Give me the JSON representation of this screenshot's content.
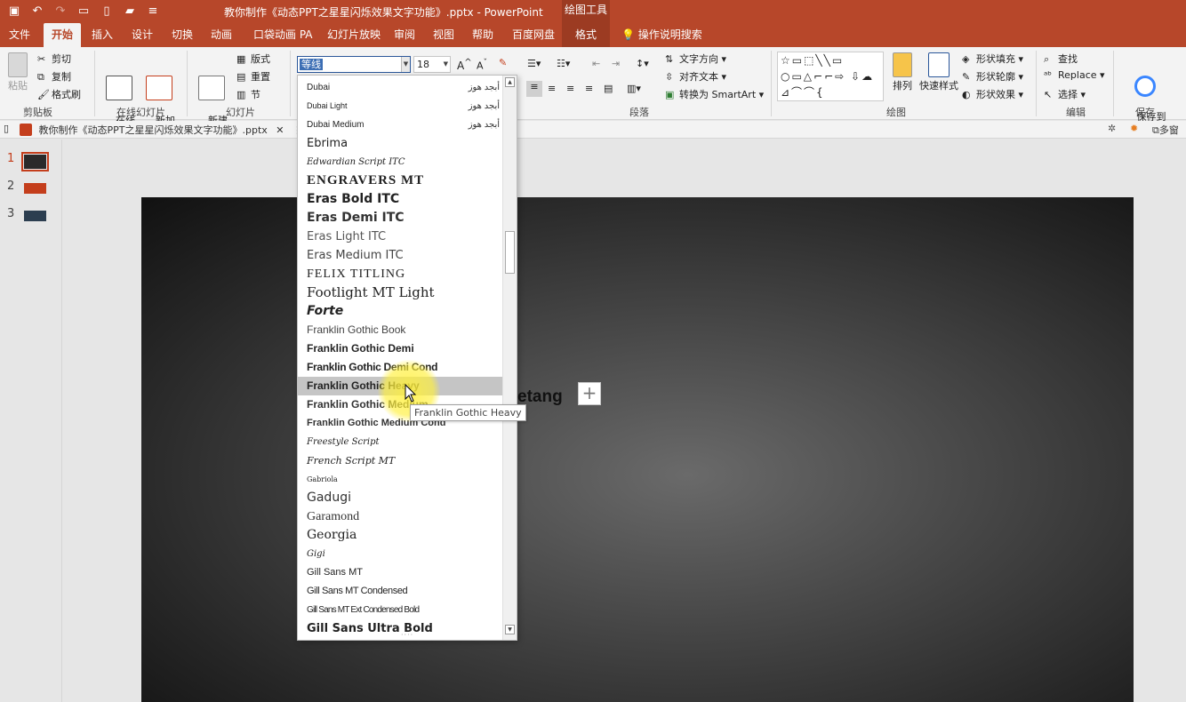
{
  "window": {
    "title": "教你制作《动态PPT之星星闪烁效果文字功能》.pptx - PowerPoint",
    "context_label": "绘图工具"
  },
  "qat": {
    "icons": [
      "save-icon",
      "undo-icon",
      "redo-icon",
      "presentation-start-icon",
      "new-file-icon",
      "open-folder-icon",
      "customize-icon"
    ]
  },
  "tabs": [
    {
      "label": "文件"
    },
    {
      "label": "开始"
    },
    {
      "label": "插入"
    },
    {
      "label": "设计"
    },
    {
      "label": "切换"
    },
    {
      "label": "动画"
    },
    {
      "label": "口袋动画 PA"
    },
    {
      "label": "幻灯片放映"
    },
    {
      "label": "审阅"
    },
    {
      "label": "视图"
    },
    {
      "label": "帮助"
    },
    {
      "label": "百度网盘"
    },
    {
      "label": "格式"
    },
    {
      "label": "操作说明搜索"
    }
  ],
  "ribbon": {
    "clipboard": {
      "paste": "粘贴",
      "cut": "剪切",
      "copy": "复制",
      "format_painter": "格式刷",
      "group": "剪贴板"
    },
    "online_slides": {
      "online": "在线\n幻灯片",
      "new_anim": "新加\n动画页",
      "group": "在线幻灯片"
    },
    "slides": {
      "new_slide": "新建\n幻灯片",
      "layout": "版式",
      "reset": "重置",
      "section": "节",
      "group": "幻灯片"
    },
    "font": {
      "name": "等线",
      "size": "18"
    },
    "paragraph": {
      "text_direction": "文字方向",
      "align_text": "对齐文本",
      "smartart": "转换为 SmartArt",
      "group": "段落"
    },
    "drawing": {
      "arrange": "排列",
      "quick_styles": "快速样式",
      "fill": "形状填充",
      "outline": "形状轮廓",
      "effects": "形状效果",
      "group": "绘图"
    },
    "editing": {
      "find": "查找",
      "replace": "Replace",
      "select": "选择",
      "group": "编辑"
    },
    "save": {
      "save_to": "保存到\n百度网盘",
      "group": "保存"
    }
  },
  "document_tab": {
    "label": "教你制作《动态PPT之星星闪烁效果文字功能》.pptx"
  },
  "toolbar_right": {
    "multi_window": "多窗"
  },
  "slides": [
    {
      "number": "1",
      "selected": true
    },
    {
      "number": "2",
      "selected": false
    },
    {
      "number": "3",
      "selected": false
    }
  ],
  "slide": {
    "visible_text": "etang"
  },
  "font_list": {
    "items": [
      {
        "name": "Dubai",
        "sample": "أبجد هوز"
      },
      {
        "name": "Dubai Light",
        "sample": "أبجد هوز"
      },
      {
        "name": "Dubai Medium",
        "sample": "أبجد هوز"
      },
      {
        "name": "Ebrima"
      },
      {
        "name": "Edwardian Script ITC"
      },
      {
        "name": "ENGRAVERS MT"
      },
      {
        "name": "Eras Bold ITC"
      },
      {
        "name": "Eras Demi ITC"
      },
      {
        "name": "Eras Light ITC"
      },
      {
        "name": "Eras Medium ITC"
      },
      {
        "name": "FELIX TITLING"
      },
      {
        "name": "Footlight MT Light"
      },
      {
        "name": "Forte"
      },
      {
        "name": "Franklin Gothic Book"
      },
      {
        "name": "Franklin Gothic Demi"
      },
      {
        "name": "Franklin Gothic Demi Cond"
      },
      {
        "name": "Franklin Gothic Heavy",
        "highlighted": true
      },
      {
        "name": "Franklin Gothic Medium"
      },
      {
        "name": "Franklin Gothic Medium Cond"
      },
      {
        "name": "Freestyle Script"
      },
      {
        "name": "French Script MT"
      },
      {
        "name": "Gabriola"
      },
      {
        "name": "Gadugi"
      },
      {
        "name": "Garamond"
      },
      {
        "name": "Georgia"
      },
      {
        "name": "Gigi"
      },
      {
        "name": "Gill Sans MT"
      },
      {
        "name": "Gill Sans MT Condensed"
      },
      {
        "name": "Gill Sans MT Ext Condensed Bold"
      },
      {
        "name": "Gill Sans Ultra Bold"
      }
    ]
  },
  "tooltip": {
    "text": "Franklin Gothic Heavy"
  },
  "colors": {
    "accent": "#b7472a",
    "selection": "#c5c5c5",
    "highlight_glow": "#fff03c"
  }
}
